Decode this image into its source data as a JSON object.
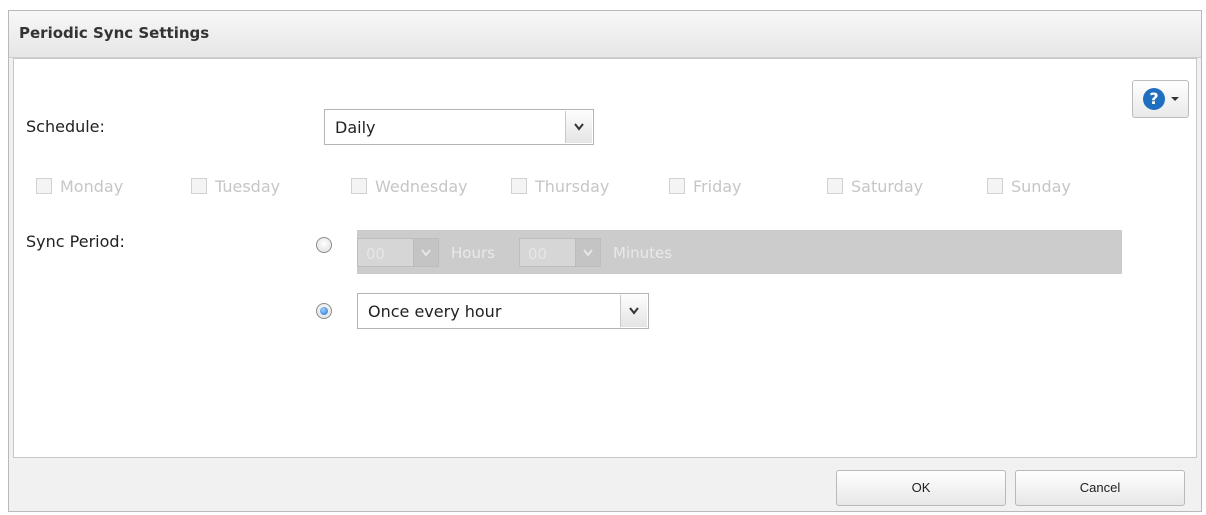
{
  "dialog": {
    "title": "Periodic Sync Settings"
  },
  "help": {
    "icon": "help-icon",
    "label": "?"
  },
  "schedule": {
    "label": "Schedule:",
    "selected": "Daily"
  },
  "weekdays": [
    {
      "label": "Monday",
      "checked": false,
      "enabled": false
    },
    {
      "label": "Tuesday",
      "checked": false,
      "enabled": false
    },
    {
      "label": "Wednesday",
      "checked": false,
      "enabled": false
    },
    {
      "label": "Thursday",
      "checked": false,
      "enabled": false
    },
    {
      "label": "Friday",
      "checked": false,
      "enabled": false
    },
    {
      "label": "Saturday",
      "checked": false,
      "enabled": false
    },
    {
      "label": "Sunday",
      "checked": false,
      "enabled": false
    }
  ],
  "sync_period": {
    "label": "Sync Period:",
    "custom": {
      "selected": false,
      "hours_value": "00",
      "hours_unit": "Hours",
      "minutes_value": "00",
      "minutes_unit": "Minutes"
    },
    "preset": {
      "selected": true,
      "value": "Once every hour"
    }
  },
  "footer": {
    "ok_label": "OK",
    "cancel_label": "Cancel"
  },
  "colors": {
    "accent": "#1f6fd0",
    "disabled_text": "#c6c6c6"
  }
}
